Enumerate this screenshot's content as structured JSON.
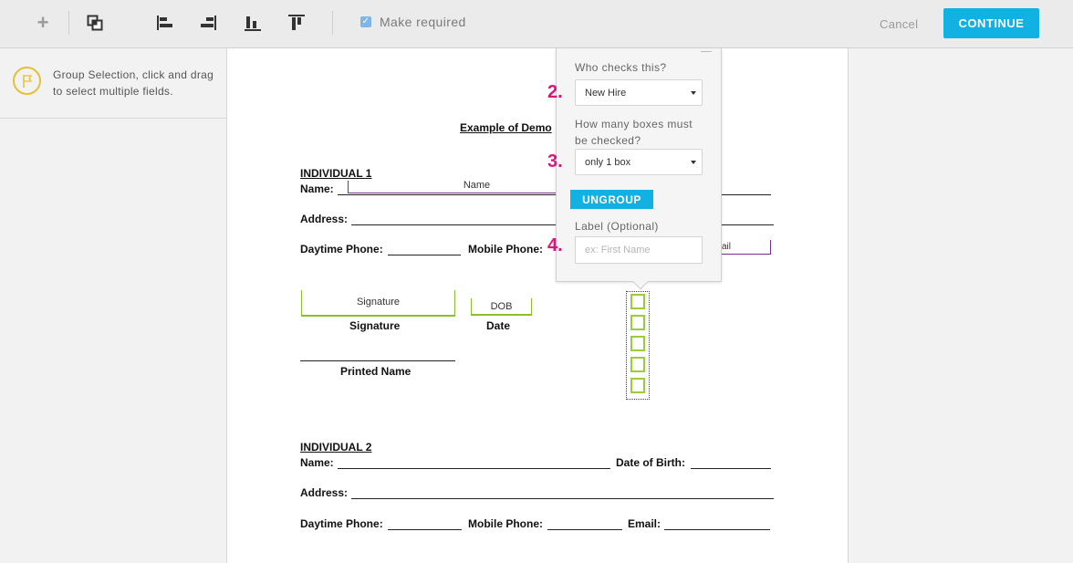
{
  "toolbar": {
    "add_icon": "plus-icon",
    "group_icon": "group-fields-icon",
    "align_icons": [
      "align-left-icon",
      "align-right-icon",
      "align-bottom-icon",
      "align-top-icon"
    ],
    "make_required_label": "Make required",
    "make_required_checked": true,
    "cancel_label": "Cancel",
    "continue_label": "CONTINUE"
  },
  "left_panel": {
    "hint_icon": "flag-icon",
    "hint_text": "Group Selection, click and drag to select multiple fields."
  },
  "document": {
    "title": "Example of Demo",
    "individual1": {
      "heading": "INDIVIDUAL 1",
      "name_label": "Name:",
      "name_field": "Name",
      "address_label": "Address:",
      "daytime_phone_label": "Daytime Phone:",
      "mobile_phone_label": "Mobile Phone:",
      "email_field_fragment": "ail",
      "signature_field": "Signature",
      "signature_label": "Signature",
      "dob_field": "DOB",
      "date_label": "Date",
      "printed_name_label": "Printed Name",
      "checkbox_count": 5
    },
    "individual2": {
      "heading": "INDIVIDUAL 2",
      "name_label": "Name:",
      "dob_label": "Date of Birth:",
      "address_label": "Address:",
      "daytime_phone_label": "Daytime Phone:",
      "mobile_phone_label": "Mobile Phone:",
      "email_label": "Email:"
    }
  },
  "popover": {
    "who_checks_label": "Who checks this?",
    "who_checks_value": "New Hire",
    "how_many_label_line1": "How many boxes must",
    "how_many_label_line2": "be checked?",
    "how_many_value": "only 1 box",
    "ungroup_label": "UNGROUP",
    "label_title": "Label (Optional)",
    "label_placeholder": "ex: First Name",
    "label_value": ""
  },
  "steps": [
    "2.",
    "3.",
    "4."
  ],
  "colors": {
    "accent": "#12b1e4",
    "step_color": "#e0137a",
    "field_green": "#8bbf2f",
    "field_purple": "#7a2f8c",
    "hint_icon": "#e2c13a"
  }
}
